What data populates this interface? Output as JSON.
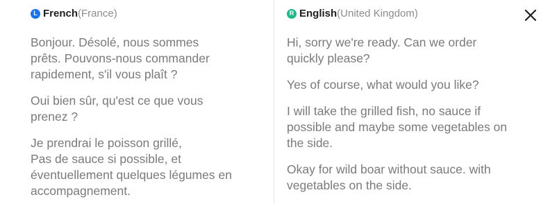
{
  "source_panel": {
    "badge_letter": "L",
    "badge_color": "#1a73e8",
    "language": "French",
    "region": "(France)",
    "messages": [
      "Bonjour. Désolé, nous sommes\nprêts. Pouvons-nous commander\nrapidement, s'il vous plaît ?",
      "Oui bien sûr, qu'est ce que vous\nprenez ?",
      "Je prendrai le poisson grillé,\nPas de sauce si possible, et\néventuellement quelques légumes en\naccompagnement."
    ]
  },
  "target_panel": {
    "badge_letter": "R",
    "badge_color": "#1fb98a",
    "language": "English",
    "region": "(United Kingdom)",
    "messages": [
      "Hi, sorry we're ready. Can we order\nquickly please?",
      "Yes of course, what would you like?",
      "I will take the grilled fish, no sauce if\npossible and maybe some vegetables on\nthe side.",
      "Okay for wild boar without sauce. with\nvegetables on the side."
    ]
  },
  "close_icon": "close-icon"
}
